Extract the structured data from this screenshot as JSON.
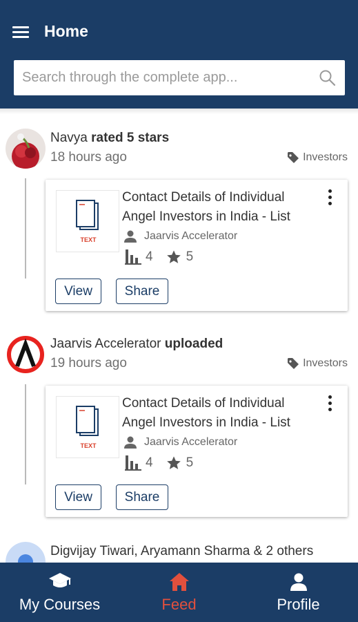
{
  "header": {
    "title": "Home",
    "search_placeholder": "Search through the complete app..."
  },
  "feed": [
    {
      "actor": "Navya",
      "action": "rated 5 stars",
      "time": "18 hours ago",
      "tag": "Investors",
      "card": {
        "title": "Contact Details of Individual Angel Investors in India - List",
        "author": "Jaarvis Accelerator",
        "views": "4",
        "rating": "5",
        "file_type": "TEXT",
        "view_label": "View",
        "share_label": "Share"
      }
    },
    {
      "actor": "Jaarvis Accelerator",
      "action": "uploaded",
      "time": "19 hours ago",
      "tag": "Investors",
      "card": {
        "title": "Contact Details of Individual Angel Investors in India - List",
        "author": "Jaarvis Accelerator",
        "views": "4",
        "rating": "5",
        "file_type": "TEXT",
        "view_label": "View",
        "share_label": "Share"
      }
    },
    {
      "actor": "Digvijay Tiwari, Aryamann Sharma & 2 others"
    }
  ],
  "bottom_nav": {
    "items": [
      {
        "label": "My Courses",
        "icon": "graduation-cap-icon"
      },
      {
        "label": "Feed",
        "icon": "home-icon",
        "active": true
      },
      {
        "label": "Profile",
        "icon": "person-icon"
      }
    ]
  },
  "colors": {
    "primary": "#1b3d66",
    "accent": "#e2503d"
  }
}
